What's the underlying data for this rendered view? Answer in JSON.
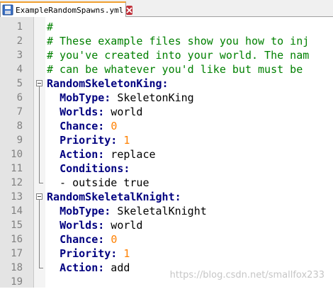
{
  "tab": {
    "filename": "ExampleRandomSpawns.yml"
  },
  "lines": [
    {
      "n": "1",
      "parts": [
        {
          "t": "#",
          "c": "cmt"
        }
      ]
    },
    {
      "n": "2",
      "parts": [
        {
          "t": "# These example files show you how to inj",
          "c": "cmt"
        }
      ]
    },
    {
      "n": "3",
      "parts": [
        {
          "t": "# you've created into your world. The nam",
          "c": "cmt"
        }
      ]
    },
    {
      "n": "4",
      "parts": [
        {
          "t": "# can be whatever you'd like but must be",
          "c": "cmt"
        }
      ]
    },
    {
      "n": "5",
      "fold": "start",
      "parts": [
        {
          "t": "RandomSkeletonKing:",
          "c": "key"
        }
      ]
    },
    {
      "n": "6",
      "parts": [
        {
          "t": "  "
        },
        {
          "t": "MobType:",
          "c": "key"
        },
        {
          "t": " SkeletonKing"
        }
      ]
    },
    {
      "n": "7",
      "parts": [
        {
          "t": "  "
        },
        {
          "t": "Worlds:",
          "c": "key"
        },
        {
          "t": " world"
        }
      ]
    },
    {
      "n": "8",
      "parts": [
        {
          "t": "  "
        },
        {
          "t": "Chance:",
          "c": "key"
        },
        {
          "t": " "
        },
        {
          "t": "0",
          "c": "num"
        }
      ]
    },
    {
      "n": "9",
      "parts": [
        {
          "t": "  "
        },
        {
          "t": "Priority:",
          "c": "key"
        },
        {
          "t": " "
        },
        {
          "t": "1",
          "c": "num"
        }
      ]
    },
    {
      "n": "10",
      "parts": [
        {
          "t": "  "
        },
        {
          "t": "Action:",
          "c": "key"
        },
        {
          "t": " replace"
        }
      ]
    },
    {
      "n": "11",
      "parts": [
        {
          "t": "  "
        },
        {
          "t": "Conditions:",
          "c": "key"
        }
      ]
    },
    {
      "n": "12",
      "fold": "end",
      "parts": [
        {
          "t": "  - outside true"
        }
      ]
    },
    {
      "n": "13",
      "fold": "start",
      "parts": [
        {
          "t": "RandomSkeletalKnight:",
          "c": "key"
        }
      ]
    },
    {
      "n": "14",
      "parts": [
        {
          "t": "  "
        },
        {
          "t": "MobType:",
          "c": "key"
        },
        {
          "t": " SkeletalKnight"
        }
      ]
    },
    {
      "n": "15",
      "parts": [
        {
          "t": "  "
        },
        {
          "t": "Worlds:",
          "c": "key"
        },
        {
          "t": " world"
        }
      ]
    },
    {
      "n": "16",
      "parts": [
        {
          "t": "  "
        },
        {
          "t": "Chance:",
          "c": "key"
        },
        {
          "t": " "
        },
        {
          "t": "0",
          "c": "num"
        }
      ]
    },
    {
      "n": "17",
      "parts": [
        {
          "t": "  "
        },
        {
          "t": "Priority:",
          "c": "key"
        },
        {
          "t": " "
        },
        {
          "t": "1",
          "c": "num"
        }
      ]
    },
    {
      "n": "18",
      "fold": "end",
      "parts": [
        {
          "t": "  "
        },
        {
          "t": "Action:",
          "c": "key"
        },
        {
          "t": " add"
        }
      ]
    },
    {
      "n": "19",
      "parts": []
    }
  ],
  "watermark": "https://blog.csdn.net/smallfox233",
  "colors": {
    "comment": "#008000",
    "key": "#000080",
    "number": "#ff8000",
    "tab_accent": "#f0a030",
    "close": "#c0303a"
  },
  "icons": {
    "tab": "file-save-icon",
    "close": "close-icon"
  }
}
